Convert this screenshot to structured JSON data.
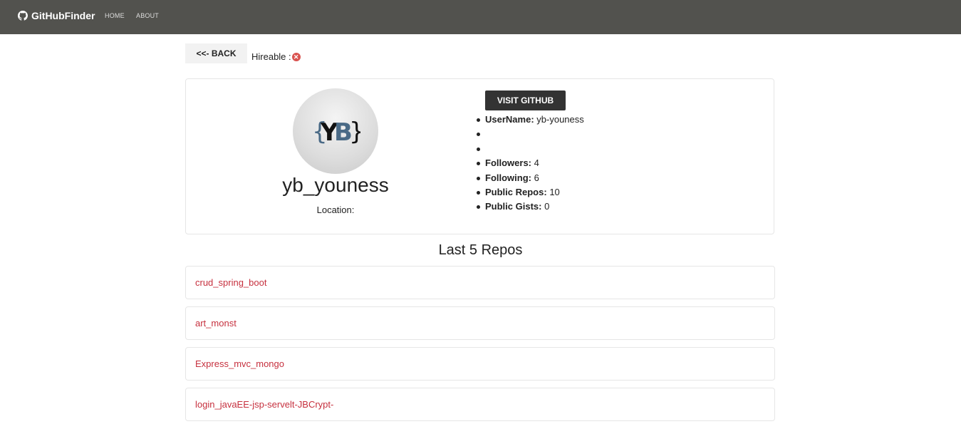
{
  "navbar": {
    "brand": "GitHubFinder",
    "links": [
      "HOME",
      "ABOUT"
    ]
  },
  "toolbar": {
    "back_label": "<<- BACK",
    "hireable_label": "Hireable :",
    "hireable_icon": "x-circle-icon",
    "hireable_status": "not hireable"
  },
  "profile": {
    "name": "yb_youness",
    "location_label": "Location:",
    "visit_label": "VISIT GITHUB",
    "details": [
      {
        "label": "UserName:",
        "value": "yb-youness"
      },
      {
        "label": "",
        "value": ""
      },
      {
        "label": "",
        "value": ""
      },
      {
        "label": "Followers:",
        "value": "4"
      },
      {
        "label": "Following:",
        "value": "6"
      },
      {
        "label": "Public Repos:",
        "value": "10"
      },
      {
        "label": "Public Gists:",
        "value": "0"
      }
    ]
  },
  "repos": {
    "title": "Last 5 Repos",
    "items": [
      "crud_spring_boot",
      "art_monst",
      "Express_mvc_mongo",
      "login_javaEE-jsp-servelt-JBCrypt-"
    ]
  },
  "colors": {
    "navbar": "#52524e",
    "repo_link": "#c6303e",
    "visit_button": "#333333",
    "hireable_icon": "#d9534f"
  }
}
